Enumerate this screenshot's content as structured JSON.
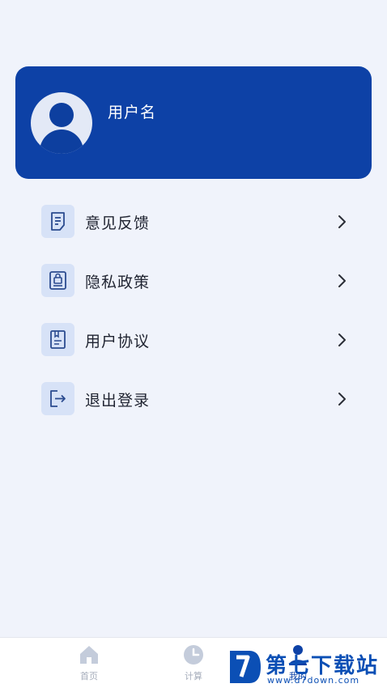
{
  "profile": {
    "username": "用户名",
    "avatar_icon": "user-avatar-icon"
  },
  "menu": {
    "items": [
      {
        "label": "意见反馈",
        "icon": "feedback-icon"
      },
      {
        "label": "隐私政策",
        "icon": "privacy-icon"
      },
      {
        "label": "用户协议",
        "icon": "agreement-icon"
      },
      {
        "label": "退出登录",
        "icon": "logout-icon"
      }
    ]
  },
  "tabbar": {
    "tabs": [
      {
        "label": "首页",
        "icon": "home-icon"
      },
      {
        "label": "计算",
        "icon": "clock-icon"
      },
      {
        "label": "我的",
        "icon": "user-icon",
        "active": true
      }
    ]
  },
  "watermark": {
    "title": "第七下载站",
    "url": "www.d7down.com"
  },
  "colors": {
    "brand": "#0d41a6",
    "background": "#f0f3fb",
    "icon_bg": "#d7e2f7"
  }
}
